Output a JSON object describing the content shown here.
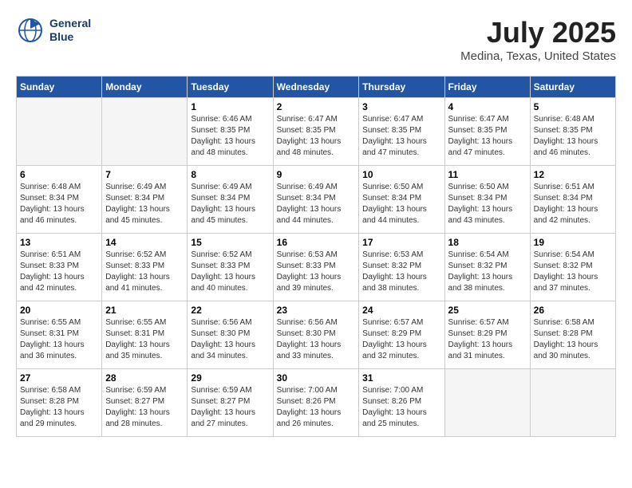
{
  "header": {
    "logo_line1": "General",
    "logo_line2": "Blue",
    "month_year": "July 2025",
    "location": "Medina, Texas, United States"
  },
  "days_of_week": [
    "Sunday",
    "Monday",
    "Tuesday",
    "Wednesday",
    "Thursday",
    "Friday",
    "Saturday"
  ],
  "weeks": [
    [
      {
        "day": "",
        "sunrise": "",
        "sunset": "",
        "daylight": ""
      },
      {
        "day": "",
        "sunrise": "",
        "sunset": "",
        "daylight": ""
      },
      {
        "day": "1",
        "sunrise": "Sunrise: 6:46 AM",
        "sunset": "Sunset: 8:35 PM",
        "daylight": "Daylight: 13 hours and 48 minutes."
      },
      {
        "day": "2",
        "sunrise": "Sunrise: 6:47 AM",
        "sunset": "Sunset: 8:35 PM",
        "daylight": "Daylight: 13 hours and 48 minutes."
      },
      {
        "day": "3",
        "sunrise": "Sunrise: 6:47 AM",
        "sunset": "Sunset: 8:35 PM",
        "daylight": "Daylight: 13 hours and 47 minutes."
      },
      {
        "day": "4",
        "sunrise": "Sunrise: 6:47 AM",
        "sunset": "Sunset: 8:35 PM",
        "daylight": "Daylight: 13 hours and 47 minutes."
      },
      {
        "day": "5",
        "sunrise": "Sunrise: 6:48 AM",
        "sunset": "Sunset: 8:35 PM",
        "daylight": "Daylight: 13 hours and 46 minutes."
      }
    ],
    [
      {
        "day": "6",
        "sunrise": "Sunrise: 6:48 AM",
        "sunset": "Sunset: 8:34 PM",
        "daylight": "Daylight: 13 hours and 46 minutes."
      },
      {
        "day": "7",
        "sunrise": "Sunrise: 6:49 AM",
        "sunset": "Sunset: 8:34 PM",
        "daylight": "Daylight: 13 hours and 45 minutes."
      },
      {
        "day": "8",
        "sunrise": "Sunrise: 6:49 AM",
        "sunset": "Sunset: 8:34 PM",
        "daylight": "Daylight: 13 hours and 45 minutes."
      },
      {
        "day": "9",
        "sunrise": "Sunrise: 6:49 AM",
        "sunset": "Sunset: 8:34 PM",
        "daylight": "Daylight: 13 hours and 44 minutes."
      },
      {
        "day": "10",
        "sunrise": "Sunrise: 6:50 AM",
        "sunset": "Sunset: 8:34 PM",
        "daylight": "Daylight: 13 hours and 44 minutes."
      },
      {
        "day": "11",
        "sunrise": "Sunrise: 6:50 AM",
        "sunset": "Sunset: 8:34 PM",
        "daylight": "Daylight: 13 hours and 43 minutes."
      },
      {
        "day": "12",
        "sunrise": "Sunrise: 6:51 AM",
        "sunset": "Sunset: 8:34 PM",
        "daylight": "Daylight: 13 hours and 42 minutes."
      }
    ],
    [
      {
        "day": "13",
        "sunrise": "Sunrise: 6:51 AM",
        "sunset": "Sunset: 8:33 PM",
        "daylight": "Daylight: 13 hours and 42 minutes."
      },
      {
        "day": "14",
        "sunrise": "Sunrise: 6:52 AM",
        "sunset": "Sunset: 8:33 PM",
        "daylight": "Daylight: 13 hours and 41 minutes."
      },
      {
        "day": "15",
        "sunrise": "Sunrise: 6:52 AM",
        "sunset": "Sunset: 8:33 PM",
        "daylight": "Daylight: 13 hours and 40 minutes."
      },
      {
        "day": "16",
        "sunrise": "Sunrise: 6:53 AM",
        "sunset": "Sunset: 8:33 PM",
        "daylight": "Daylight: 13 hours and 39 minutes."
      },
      {
        "day": "17",
        "sunrise": "Sunrise: 6:53 AM",
        "sunset": "Sunset: 8:32 PM",
        "daylight": "Daylight: 13 hours and 38 minutes."
      },
      {
        "day": "18",
        "sunrise": "Sunrise: 6:54 AM",
        "sunset": "Sunset: 8:32 PM",
        "daylight": "Daylight: 13 hours and 38 minutes."
      },
      {
        "day": "19",
        "sunrise": "Sunrise: 6:54 AM",
        "sunset": "Sunset: 8:32 PM",
        "daylight": "Daylight: 13 hours and 37 minutes."
      }
    ],
    [
      {
        "day": "20",
        "sunrise": "Sunrise: 6:55 AM",
        "sunset": "Sunset: 8:31 PM",
        "daylight": "Daylight: 13 hours and 36 minutes."
      },
      {
        "day": "21",
        "sunrise": "Sunrise: 6:55 AM",
        "sunset": "Sunset: 8:31 PM",
        "daylight": "Daylight: 13 hours and 35 minutes."
      },
      {
        "day": "22",
        "sunrise": "Sunrise: 6:56 AM",
        "sunset": "Sunset: 8:30 PM",
        "daylight": "Daylight: 13 hours and 34 minutes."
      },
      {
        "day": "23",
        "sunrise": "Sunrise: 6:56 AM",
        "sunset": "Sunset: 8:30 PM",
        "daylight": "Daylight: 13 hours and 33 minutes."
      },
      {
        "day": "24",
        "sunrise": "Sunrise: 6:57 AM",
        "sunset": "Sunset: 8:29 PM",
        "daylight": "Daylight: 13 hours and 32 minutes."
      },
      {
        "day": "25",
        "sunrise": "Sunrise: 6:57 AM",
        "sunset": "Sunset: 8:29 PM",
        "daylight": "Daylight: 13 hours and 31 minutes."
      },
      {
        "day": "26",
        "sunrise": "Sunrise: 6:58 AM",
        "sunset": "Sunset: 8:28 PM",
        "daylight": "Daylight: 13 hours and 30 minutes."
      }
    ],
    [
      {
        "day": "27",
        "sunrise": "Sunrise: 6:58 AM",
        "sunset": "Sunset: 8:28 PM",
        "daylight": "Daylight: 13 hours and 29 minutes."
      },
      {
        "day": "28",
        "sunrise": "Sunrise: 6:59 AM",
        "sunset": "Sunset: 8:27 PM",
        "daylight": "Daylight: 13 hours and 28 minutes."
      },
      {
        "day": "29",
        "sunrise": "Sunrise: 6:59 AM",
        "sunset": "Sunset: 8:27 PM",
        "daylight": "Daylight: 13 hours and 27 minutes."
      },
      {
        "day": "30",
        "sunrise": "Sunrise: 7:00 AM",
        "sunset": "Sunset: 8:26 PM",
        "daylight": "Daylight: 13 hours and 26 minutes."
      },
      {
        "day": "31",
        "sunrise": "Sunrise: 7:00 AM",
        "sunset": "Sunset: 8:26 PM",
        "daylight": "Daylight: 13 hours and 25 minutes."
      },
      {
        "day": "",
        "sunrise": "",
        "sunset": "",
        "daylight": ""
      },
      {
        "day": "",
        "sunrise": "",
        "sunset": "",
        "daylight": ""
      }
    ]
  ]
}
